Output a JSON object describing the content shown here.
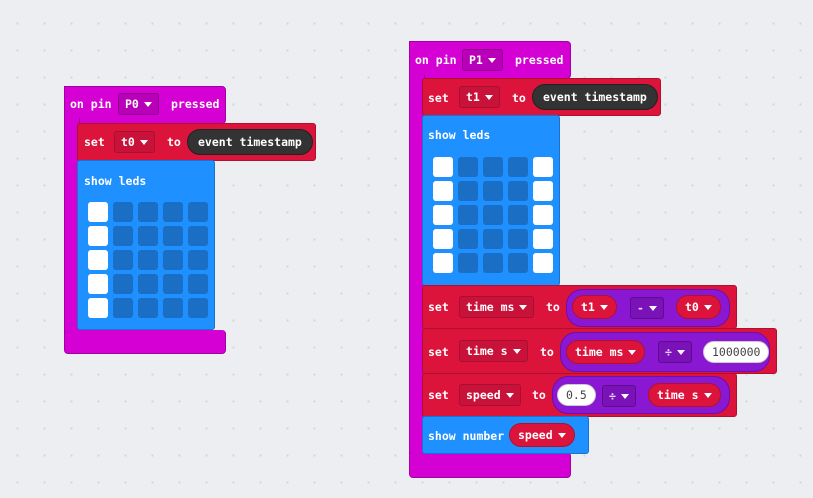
{
  "block1": {
    "hat": {
      "prefix": "on pin",
      "pin": "P0",
      "suffix": "pressed"
    },
    "set": {
      "label": "set",
      "var": "t0",
      "to": "to",
      "value": "event timestamp"
    },
    "show_leds": {
      "label": "show leds",
      "grid": [
        [
          1,
          0,
          0,
          0,
          0
        ],
        [
          1,
          0,
          0,
          0,
          0
        ],
        [
          1,
          0,
          0,
          0,
          0
        ],
        [
          1,
          0,
          0,
          0,
          0
        ],
        [
          1,
          0,
          0,
          0,
          0
        ]
      ]
    }
  },
  "block2": {
    "hat": {
      "prefix": "on pin",
      "pin": "P1",
      "suffix": "pressed"
    },
    "set_t1": {
      "label": "set",
      "var": "t1",
      "to": "to",
      "value": "event timestamp"
    },
    "show_leds": {
      "label": "show leds",
      "grid": [
        [
          1,
          0,
          0,
          0,
          1
        ],
        [
          1,
          0,
          0,
          0,
          1
        ],
        [
          1,
          0,
          0,
          0,
          1
        ],
        [
          1,
          0,
          0,
          0,
          1
        ],
        [
          1,
          0,
          0,
          0,
          1
        ]
      ]
    },
    "set_time_ms": {
      "label": "set",
      "var": "time ms",
      "to": "to",
      "left": "t1",
      "op": "-",
      "right": "t0"
    },
    "set_time_s": {
      "label": "set",
      "var": "time s",
      "to": "to",
      "left": "time ms",
      "op": "÷",
      "right": "1000000"
    },
    "set_speed": {
      "label": "set",
      "var": "speed",
      "to": "to",
      "left": "0.5",
      "op": "÷",
      "right": "time s"
    },
    "show_number": {
      "label": "show number",
      "value": "speed"
    }
  },
  "colors": {
    "hat": "#d400d4",
    "variables": "#dc143c",
    "basic": "#1e90ff",
    "math": "#8a17d1",
    "led_on": "#ffffff",
    "led_off": "#1a6fc4",
    "input_dark": "#333333"
  }
}
